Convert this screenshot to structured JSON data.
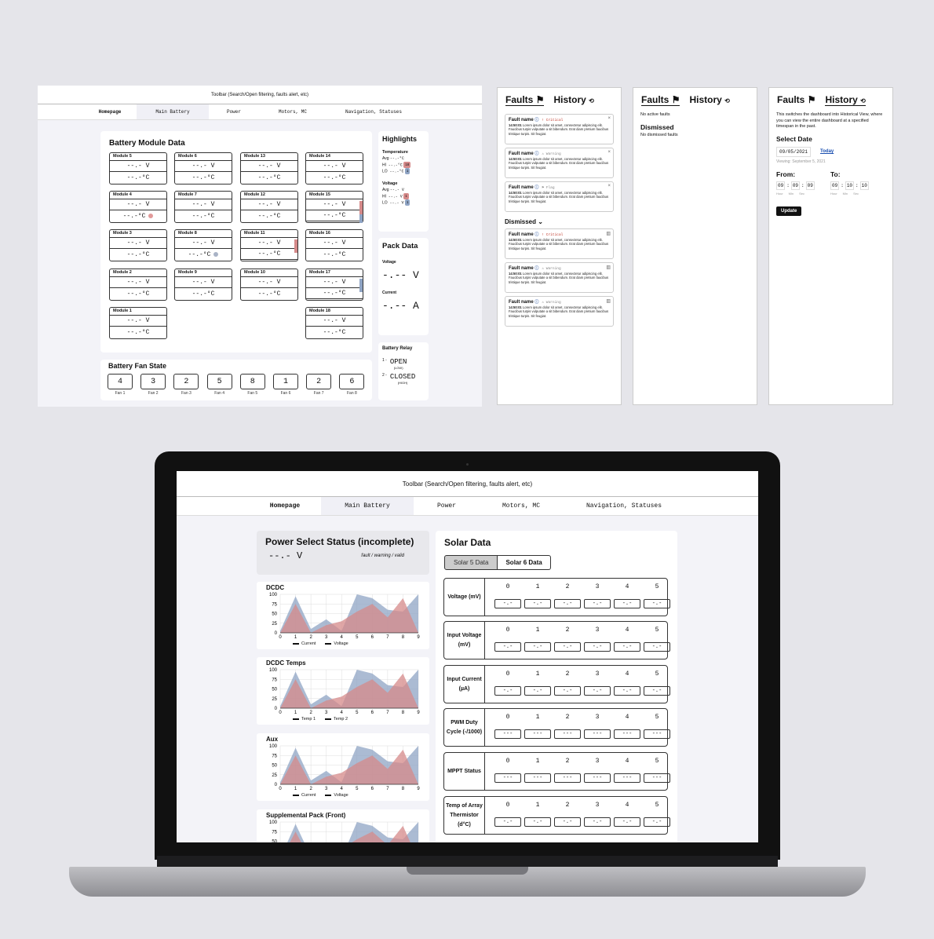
{
  "toolbar": {
    "text": "Toolbar (Search/Open filtering, faults alert, etc)"
  },
  "nav": [
    "Homepage",
    "Main Battery",
    "Power",
    "Motors, MC",
    "Navigation, Statuses"
  ],
  "battery": {
    "title": "Battery Module Data",
    "modules": [
      {
        "name": "Module 5",
        "v": "--.- V",
        "t": "--.-°C"
      },
      {
        "name": "Module 6",
        "v": "--.- V",
        "t": "--.-°C"
      },
      {
        "name": "Module 13",
        "v": "--.- V",
        "t": "--.-°C"
      },
      {
        "name": "Module 14",
        "v": "--.- V",
        "t": "--.-°C"
      },
      {
        "name": "Module 4",
        "v": "--.- V",
        "t": "--.-°C"
      },
      {
        "name": "Module 7",
        "v": "--.- V",
        "t": "--.-°C"
      },
      {
        "name": "Module 12",
        "v": "--.- V",
        "t": "--.-°C"
      },
      {
        "name": "Module 15",
        "v": "--.- V",
        "t": "--.-°C"
      },
      {
        "name": "Module 3",
        "v": "--.- V",
        "t": "--.-°C"
      },
      {
        "name": "Module 8",
        "v": "--.- V",
        "t": "--.-°C"
      },
      {
        "name": "Module 11",
        "v": "--.- V",
        "t": "--.-°C"
      },
      {
        "name": "Module 16",
        "v": "--.- V",
        "t": "--.-°C"
      },
      {
        "name": "Module 2",
        "v": "--.- V",
        "t": "--.-°C"
      },
      {
        "name": "Module 9",
        "v": "--.- V",
        "t": "--.-°C"
      },
      {
        "name": "Module 10",
        "v": "--.- V",
        "t": "--.-°C"
      },
      {
        "name": "Module 17",
        "v": "--.- V",
        "t": "--.-°C"
      },
      {
        "name": "Module 1",
        "v": "--.- V",
        "t": "--.-°C"
      },
      {
        "name": "Module 18",
        "v": "--.- V",
        "t": "--.-°C"
      }
    ]
  },
  "fan": {
    "title": "Battery Fan State",
    "values": [
      "4",
      "3",
      "2",
      "5",
      "8",
      "1",
      "2",
      "6"
    ],
    "labels": [
      "Fan 1",
      "Fan 2",
      "Fan 3",
      "Fan 4",
      "Fan 5",
      "Fan 6",
      "Fan 7",
      "Fan 8"
    ]
  },
  "highlights": {
    "title": "Highlights",
    "temp_label": "Temperature",
    "volt_label": "Voltage",
    "temp": {
      "avg": "Avg",
      "avg_v": "--.-°C",
      "hi": "HI",
      "hi_v": "--.-°C",
      "hi_badge": "18",
      "lo": "LO",
      "lo_v": "--.-°C",
      "lo_badge": "1"
    },
    "volt": {
      "avg": "Avg",
      "avg_v": "--.- V",
      "hi": "HI",
      "hi_v": "--.- V",
      "hi_badge": "1",
      "lo": "LO",
      "lo_v": "--.- V",
      "lo_badge": "1"
    }
  },
  "pack": {
    "title": "Pack Data",
    "voltage_label": "Voltage",
    "voltage": "-.-- V",
    "current_label": "Current",
    "current": "-.-- A"
  },
  "relay": {
    "title": "Battery Relay",
    "r1_num": "1 -",
    "r1": "OPEN",
    "r1_sub": "(LOW)",
    "r2_num": "2 -",
    "r2": "CLOSED",
    "r2_sub": "(HIGH)"
  },
  "faults": {
    "tab_faults": "Faults",
    "tab_history": "History",
    "body": "Lorem ipsum dolor sit amet, consectetur adipiscing elit. Faucibus turpis vulputate a sit bibendum. Erat diam pretium faucibus tristique turpis. Sit feugiat.",
    "time": "14:50:01",
    "fault_name": "Fault name",
    "active": [
      {
        "level": "! Critical",
        "color": "#c0392b"
      },
      {
        "level": "⚠ Warning",
        "color": "#888"
      },
      {
        "level": "⚑ Flag",
        "color": "#888"
      }
    ],
    "dismissed_label": "Dismissed ⌄",
    "dismissed": [
      {
        "level": "! Critical",
        "color": "#c0392b"
      },
      {
        "level": "⚠ Warning",
        "color": "#888"
      },
      {
        "level": "⚠ Warning",
        "color": "#888"
      }
    ],
    "no_active": "No active faults",
    "dismissed_title": "Dismissed",
    "no_dismissed": "No dismissed faults"
  },
  "history": {
    "desc": "This switches the dashboard into Historical View, where you can view the entire dashboard at a specified timespan in the past.",
    "select_date": "Select Date",
    "date": "09/05/2021",
    "today": "Today",
    "viewing": "Viewing: September 5, 2021",
    "from": "From:",
    "to": "To:",
    "from_h": "09",
    "from_m": "09",
    "from_s": "09",
    "to_h": "09",
    "to_m": "10",
    "to_s": "10",
    "hour": "Hour",
    "min": "Min",
    "sec": "Sec",
    "update": "Update"
  },
  "power": {
    "title": "Power Select Status (incomplete)",
    "value": "--.- V",
    "legend": "fault / warning / valid"
  },
  "charts": [
    {
      "title": "DCDC",
      "legend": [
        "Current",
        "Voltage"
      ]
    },
    {
      "title": "DCDC Temps",
      "legend": [
        "Temp 1",
        "Temp 2"
      ]
    },
    {
      "title": "Aux",
      "legend": [
        "Current",
        "Voltage"
      ]
    },
    {
      "title": "Supplemental Pack (Front)",
      "legend": [
        "",
        ""
      ]
    }
  ],
  "chart_data": {
    "type": "area",
    "x": [
      0,
      1,
      2,
      3,
      4,
      5,
      6,
      7,
      8,
      9
    ],
    "yticks": [
      0,
      25,
      50,
      75,
      100
    ],
    "ylim": [
      0,
      100
    ],
    "series": [
      {
        "values": [
          5,
          95,
          10,
          35,
          5,
          100,
          90,
          60,
          55,
          100
        ],
        "color": "#8fa4c4"
      },
      {
        "values": [
          0,
          75,
          0,
          20,
          30,
          55,
          75,
          40,
          90,
          0
        ],
        "color": "#d58a8a"
      }
    ]
  },
  "solar": {
    "title": "Solar Data",
    "tab1": "Solar 5 Data",
    "tab2": "Solar 6 Data",
    "cols": [
      "0",
      "1",
      "2",
      "3",
      "4",
      "5"
    ],
    "rows": [
      {
        "label": "Voltage (mV)",
        "cell": "-.-"
      },
      {
        "label": "Input Voltage (mV)",
        "cell": "-.-"
      },
      {
        "label": "Input Current (µA)",
        "cell": "-.-"
      },
      {
        "label": "PWM Duty Cycle (-/1000)",
        "cell": "---"
      },
      {
        "label": "MPPT Status",
        "cell": "---"
      },
      {
        "label": "Temp of Array Thermistor (d°C)",
        "cell": "-.-"
      }
    ]
  }
}
